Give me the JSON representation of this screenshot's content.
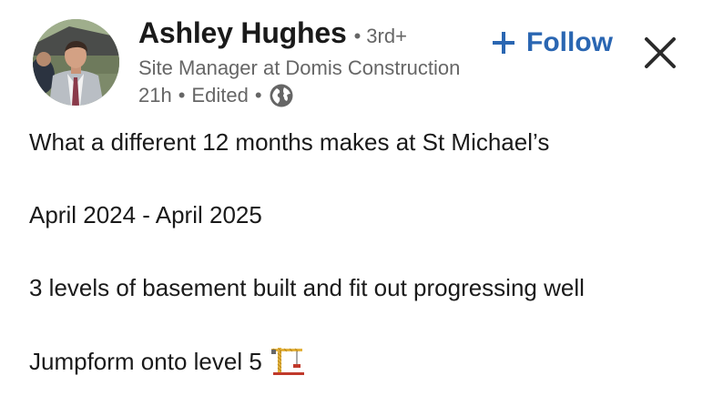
{
  "author": {
    "name": "Ashley Hughes",
    "separator": "•",
    "degree": "3rd+",
    "headline": "Site Manager at Domis Construction",
    "time": "21h",
    "edited": "Edited",
    "visibility_icon": "globe-icon",
    "avatar": "profile-photo"
  },
  "actions": {
    "follow_icon": "plus-icon",
    "follow_label": "Follow",
    "close_icon": "close-icon",
    "accent_color": "#2a66b2"
  },
  "post": {
    "paragraphs": [
      "What a different 12 months makes at St Michael’s",
      "April 2024 - April 2025",
      "3 levels of basement built and fit out progressing well",
      "Jumpform onto level 5"
    ],
    "trailing_emoji_icon": "construction-crane-icon"
  }
}
